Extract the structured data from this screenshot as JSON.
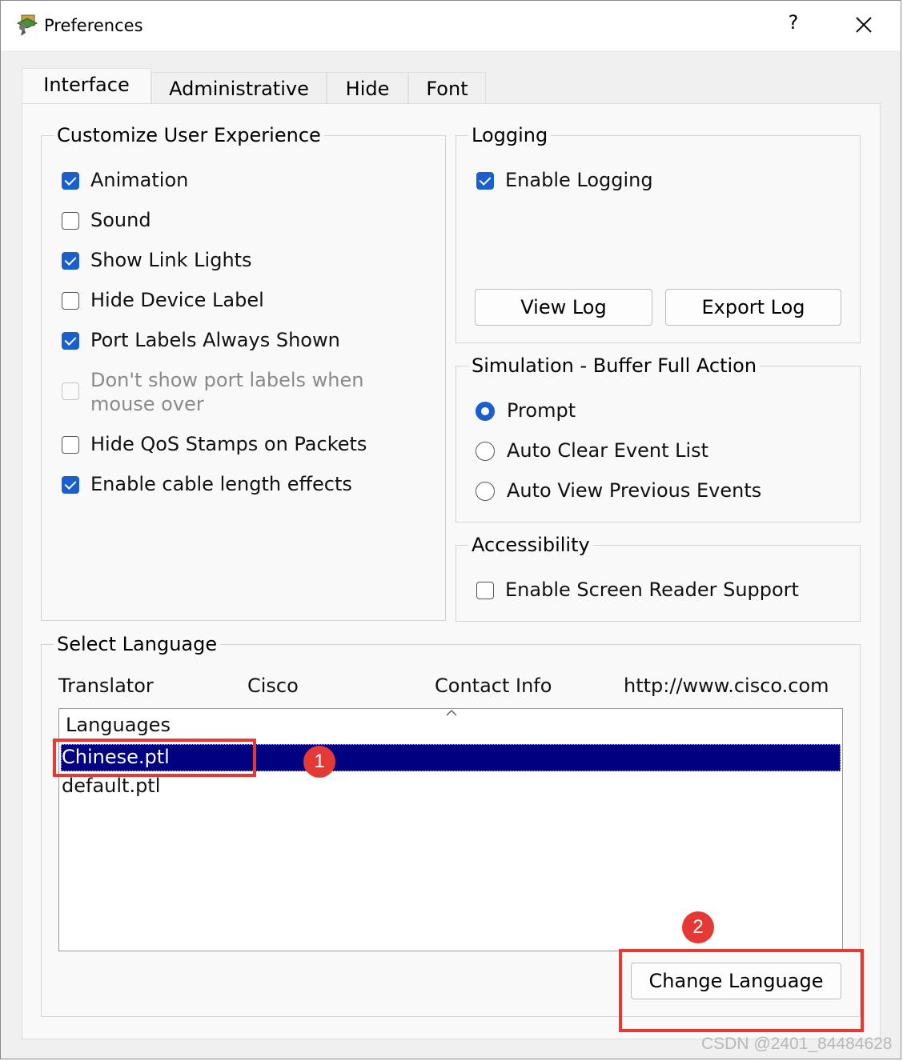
{
  "window": {
    "title": "Preferences",
    "help_label": "?"
  },
  "tabs": [
    {
      "label": "Interface",
      "active": true
    },
    {
      "label": "Administrative",
      "active": false
    },
    {
      "label": "Hide",
      "active": false
    },
    {
      "label": "Font",
      "active": false
    }
  ],
  "customize": {
    "title": "Customize User Experience",
    "options": [
      {
        "label": "Animation",
        "checked": true,
        "enabled": true
      },
      {
        "label": "Sound",
        "checked": false,
        "enabled": true
      },
      {
        "label": "Show Link Lights",
        "checked": true,
        "enabled": true
      },
      {
        "label": "Hide Device Label",
        "checked": false,
        "enabled": true
      },
      {
        "label": "Port Labels Always Shown",
        "checked": true,
        "enabled": true
      },
      {
        "label_line1": "Don't show port labels when",
        "label_line2": "mouse over",
        "checked": false,
        "enabled": false
      },
      {
        "label": "Hide QoS Stamps on Packets",
        "checked": false,
        "enabled": true
      },
      {
        "label": "Enable cable length effects",
        "checked": true,
        "enabled": true
      }
    ]
  },
  "logging": {
    "title": "Logging",
    "enable_label": "Enable Logging",
    "enable_checked": true,
    "view_log_label": "View Log",
    "export_log_label": "Export Log"
  },
  "simulation": {
    "title": "Simulation - Buffer Full Action",
    "options": [
      {
        "label": "Prompt",
        "selected": true
      },
      {
        "label": "Auto Clear Event List",
        "selected": false
      },
      {
        "label": "Auto View Previous Events",
        "selected": false
      }
    ]
  },
  "accessibility": {
    "title": "Accessibility",
    "screen_reader_label": "Enable Screen Reader Support",
    "screen_reader_checked": false
  },
  "language": {
    "title": "Select Language",
    "translator_label": "Translator",
    "translator_value": "Cisco",
    "contact_label": "Contact Info",
    "contact_value": "http://www.cisco.com",
    "list_header": "Languages",
    "items": [
      "Chinese.ptl",
      "default.ptl"
    ],
    "selected_index": 0,
    "change_button_label": "Change Language"
  },
  "annotations": {
    "marker_1": "1",
    "marker_2": "2",
    "color": "#e53935"
  },
  "watermark": "CSDN @2401_84484628",
  "colors": {
    "accent": "#1b5fcc",
    "selection": "#000080"
  }
}
